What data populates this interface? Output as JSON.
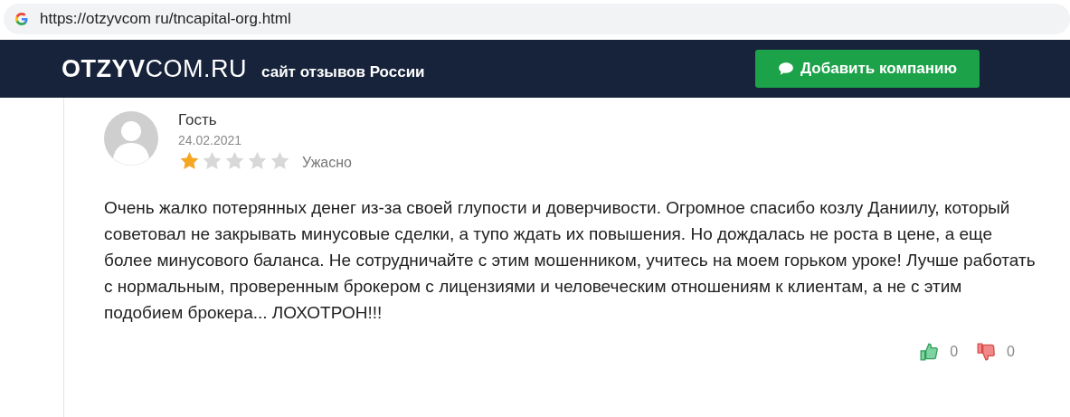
{
  "address_bar": {
    "url": "https://otzyvcom ru/tncapital-org.html"
  },
  "header": {
    "logo": "**OTZYV**COM.RU",
    "tagline": "сайт отзывов России",
    "add_button": {
      "label": "Добавить компанию"
    }
  },
  "review": {
    "author": "Гость",
    "date": "24.02.2021",
    "stars": 1,
    "rating_label": "Ужасно",
    "text": "Очень жалко потерянных денег из-за своей глупости и доверчивости. Огромное спасибо козлу Даниилу, который советовал не закрывать минусовые сделки, а тупо ждать их повышения. Но дождалась не роста в цене, а еще более минусового баланса. Не сотрудничайте с этим мошенником, учитесь на моем горьком уроке! Лучше работать с нормальным, проверенным брокером с лицензиями и человеческим отношениям к клиентам, а не с этим подобием брокера... ЛОХОТРОН!!!",
    "likes": "0",
    "dislikes": "0"
  }
}
